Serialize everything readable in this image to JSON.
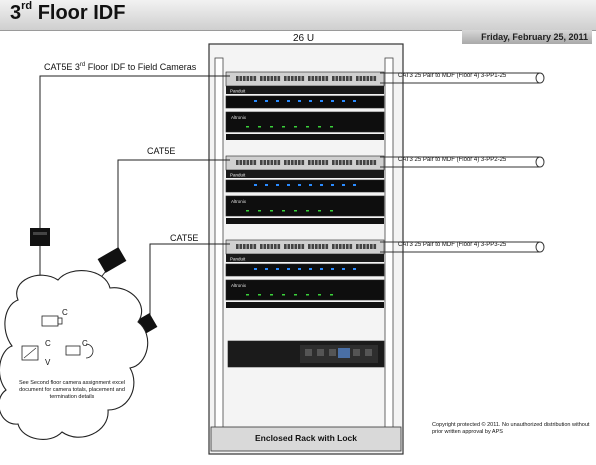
{
  "title": {
    "prefix": "3",
    "suffix": "rd",
    "rest": "Floor IDF"
  },
  "date": "Friday, February 25, 2011",
  "rack": {
    "size_label": "26 U",
    "footer_label": "Enclosed Rack with Lock",
    "panel_brand": "Panduit",
    "switch_brand": "Altronix"
  },
  "cables": {
    "field_cameras": {
      "prefix": "CAT5E 3",
      "suffix": "rd",
      "rest": " Floor IDF to Field Cameras"
    },
    "cat5e_2": "CAT5E",
    "cat5e_3": "CAT5E"
  },
  "mdf_links": [
    "CAT3 25 Pair to MDF (Floor 4)  3-PP1-25",
    "CAT3 25 Pair to MDF (Floor 4)  3-PP2-25",
    "CAT3 25 Pair to MDF (Floor 4)  3-PP3-25"
  ],
  "camera_cloud": {
    "camera_letters": [
      "C",
      "C",
      "C",
      "V"
    ],
    "note": "See Second floor camera assignment excel document for camera totals, placement and termination details"
  },
  "copyright": "Copyright protected © 2011.  No unauthorized distribution without prior written approval by APS"
}
